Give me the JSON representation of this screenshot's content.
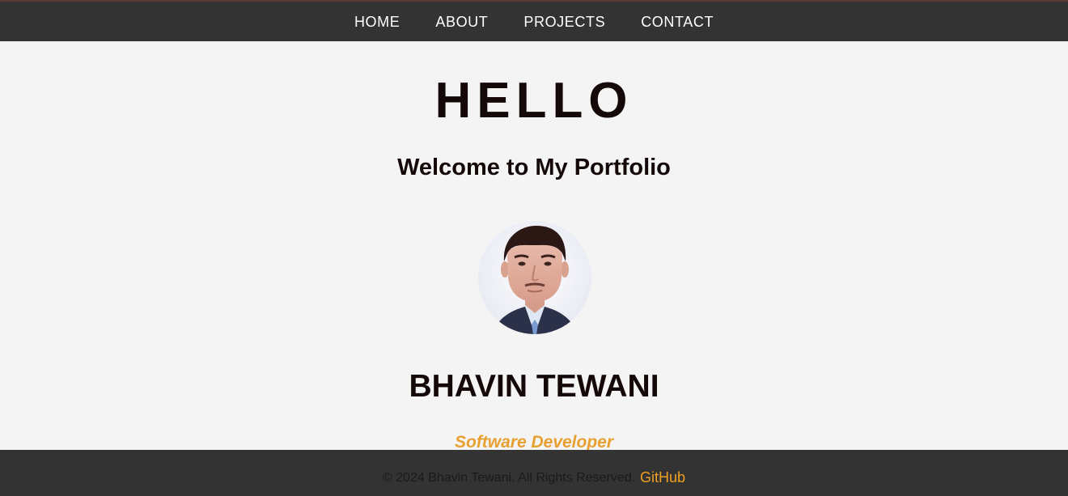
{
  "nav": {
    "items": [
      {
        "label": "HOME"
      },
      {
        "label": "ABOUT"
      },
      {
        "label": "PROJECTS"
      },
      {
        "label": "CONTACT"
      }
    ]
  },
  "hero": {
    "title": "HELLO",
    "subtitle": "Welcome to My Portfolio",
    "name": "BHAVIN TEWANI",
    "role": "Software Developer"
  },
  "footer": {
    "copyright": "© 2024 Bhavin Tewani. All Rights Reserved.",
    "github_label": "GitHub"
  },
  "colors": {
    "nav_bg": "#333333",
    "page_bg": "#f4f4f4",
    "heading": "#140808",
    "accent": "#e8a030",
    "link": "#f0a020"
  }
}
